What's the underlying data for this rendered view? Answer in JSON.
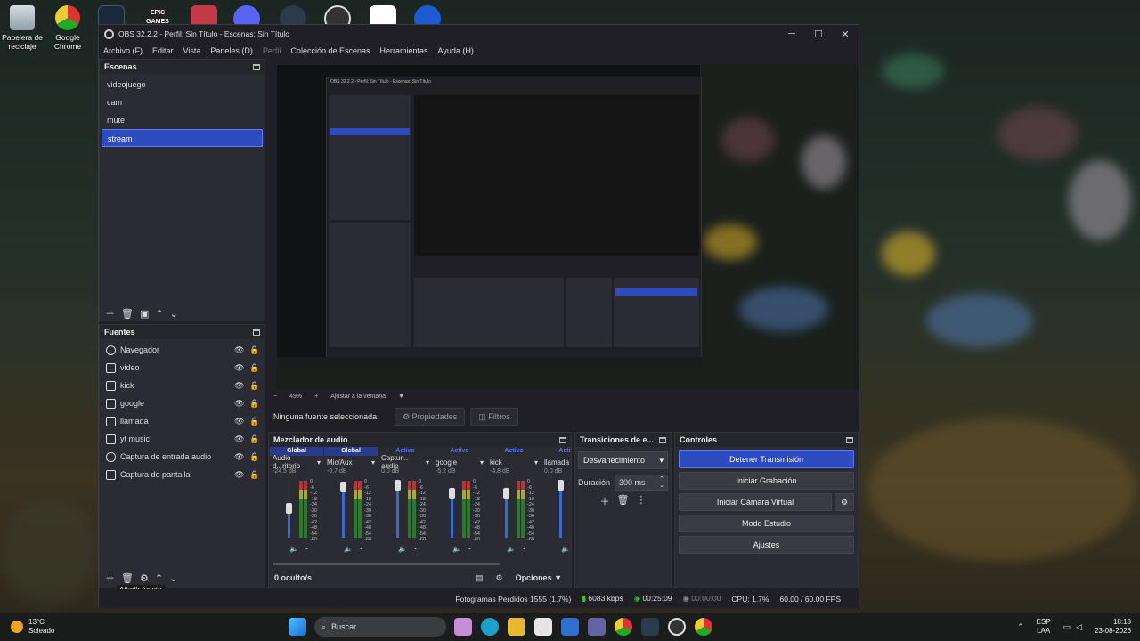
{
  "desktop": {
    "icons": [
      {
        "label": "Papelera de\nreciclaje",
        "icon": "recycle-bin-icon"
      },
      {
        "label": "Google\nChrome",
        "icon": "chrome-icon"
      }
    ],
    "topbar_icons": [
      "steam-icon",
      "epic-games-icon",
      "valorant-icon",
      "discord-icon",
      "davinci-icon",
      "obs-icon",
      "capcut-icon",
      "app-icon"
    ],
    "epic_label": "EPIC\nGAMES"
  },
  "window": {
    "title": "OBS 32.2.2 - Perfil: Sin Título - Escenas: Sin Título",
    "controls": {
      "minimize": "─",
      "maximize": "☐",
      "close": "✕"
    }
  },
  "menu": [
    "Archivo (F)",
    "Editar",
    "Vista",
    "Paneles (D)",
    "Perfil",
    "Colección de Escenas",
    "Herramientas",
    "Ayuda (H)"
  ],
  "scenes": {
    "title": "Escenas",
    "items": [
      "videojuego",
      "cam",
      "mute",
      "stream"
    ],
    "selected": "stream"
  },
  "sources": {
    "title": "Fuentes",
    "items": [
      {
        "name": "Navegador",
        "icon": "globe-icon"
      },
      {
        "name": "video",
        "icon": "video-icon"
      },
      {
        "name": "kick",
        "icon": "image-icon"
      },
      {
        "name": "google",
        "icon": "image-icon"
      },
      {
        "name": "llamada",
        "icon": "image-icon"
      },
      {
        "name": "yt music",
        "icon": "image-icon"
      },
      {
        "name": "Captura de entrada audio",
        "icon": "mic-icon"
      },
      {
        "name": "Captura de pantalla",
        "icon": "monitor-icon"
      }
    ],
    "tooltip": "Añadir fuente"
  },
  "preview": {
    "zoom": "49%",
    "fit_label": "Ajustar a la ventana",
    "inner_title": "OBS 32.2.2 - Perfil: Sin Título - Escenas: Sin Título"
  },
  "context": {
    "no_source": "Ninguna fuente seleccionada",
    "properties": "Propiedades",
    "filters": "Filtros"
  },
  "mixer": {
    "title": "Mezclador de audio",
    "channels": [
      {
        "status": "Global",
        "name": "Audio d...ritorio",
        "db": "-24.5 dB",
        "fader": 0.55,
        "level": 0.0
      },
      {
        "status": "Global",
        "name": "Mic/Aux",
        "db": "-0.7 dB",
        "fader": 0.92,
        "level": 0.55
      },
      {
        "status": "Activo",
        "name": "Captur... audio",
        "db": "0.0 dB",
        "fader": 0.95,
        "level": 0.0
      },
      {
        "status": "Activo",
        "name": "google",
        "db": "-5.2 dB",
        "fader": 0.82,
        "level": 0.0
      },
      {
        "status": "Activo",
        "name": "kick",
        "db": "-4.8 dB",
        "fader": 0.82,
        "level": 0.0
      },
      {
        "status": "Activo",
        "name": "llamada",
        "db": "0.0 dB",
        "fader": 0.95,
        "level": 0.0
      }
    ],
    "scale": [
      "0",
      "-6",
      "-12",
      "-18",
      "-24",
      "-30",
      "-36",
      "-42",
      "-48",
      "-54",
      "-60"
    ],
    "hidden": "0 oculto/s",
    "options": "Opciones"
  },
  "transitions": {
    "title": "Transiciones de e...",
    "type": "Desvanecimiento",
    "duration_label": "Duración",
    "duration_value": "300 ms"
  },
  "controls": {
    "title": "Controles",
    "stop_stream": "Detener Transmisión",
    "start_record": "Iniciar Grabación",
    "virtual_cam": "Iniciar Cámara Virtual",
    "studio_mode": "Modo Estudio",
    "settings": "Ajustes"
  },
  "status": {
    "dropped": "Fotogramas Perdidos 1555 (1.7%)",
    "bitrate": "6083 kbps",
    "stream_time": "00:25:09",
    "record_time": "00:00:00",
    "cpu": "CPU: 1.7%",
    "fps": "60.00 / 60.00 FPS"
  },
  "taskbar": {
    "weather_temp": "13°C",
    "weather_desc": "Soleado",
    "search": "Buscar",
    "lang_top": "ESP",
    "lang_bottom": "LAA",
    "time": "18:18",
    "date": "23-08-2026"
  }
}
